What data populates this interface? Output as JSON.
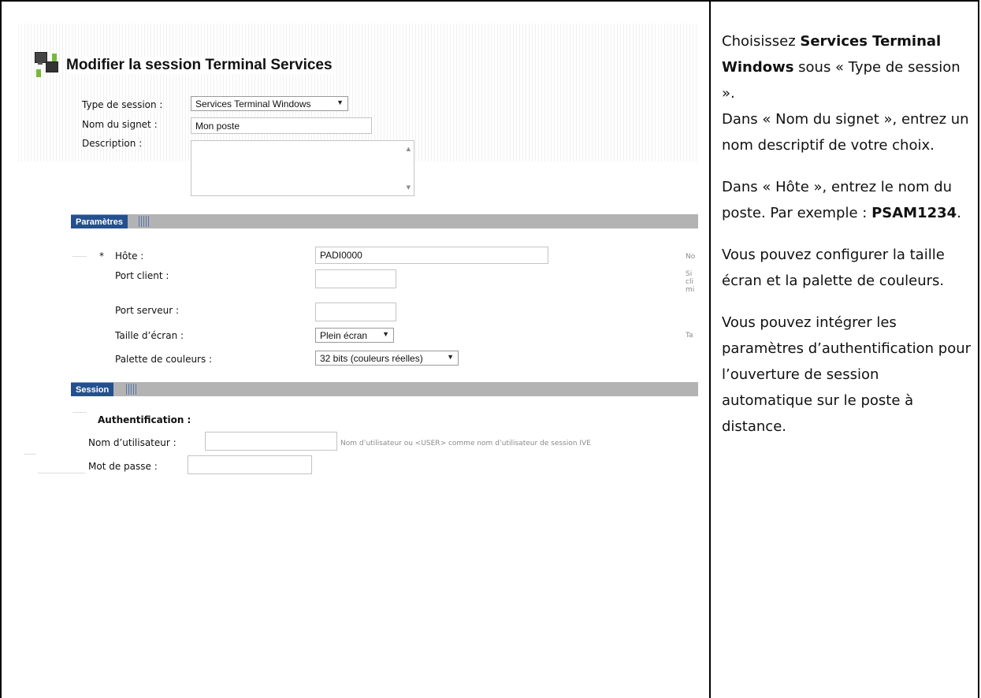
{
  "screenshot": {
    "title": "Modifier la session Terminal Services",
    "session_type_label": "Type de session :",
    "session_type_value": "Services Terminal Windows",
    "bookmark_label": "Nom du signet :",
    "bookmark_value": "Mon poste",
    "description_label": "Description :",
    "sections": {
      "parametres": "Paramètres",
      "session": "Session"
    },
    "params": {
      "required_mark": "*",
      "host_label": "Hôte :",
      "host_value": "PADI0000",
      "host_hint": "No",
      "client_port_label": "Port client :",
      "client_port_hint": "Si",
      "client_port_hint2": "cli",
      "client_port_hint3": "mi",
      "server_port_label": "Port serveur :",
      "screen_size_label": "Taille d’écran :",
      "screen_size_value": "Plein écran",
      "screen_size_hint": "Ta",
      "palette_label": "Palette de couleurs :",
      "palette_value": "32 bits (couleurs réelles)"
    },
    "session": {
      "auth_heading": "Authentification :",
      "username_label": "Nom d’utilisateur :",
      "username_hint": "Nom d’utilisateur ou <USER> comme nom d’utilisateur de session IVE",
      "password_label": "Mot de passe :"
    }
  },
  "instructions": {
    "p1_pre": "Choisissez ",
    "p1_bold": "Services Terminal Windows",
    "p1_post": " sous « Type de session ».",
    "p2": "Dans « Nom du signet », entrez un nom descriptif de votre choix.",
    "p3_pre": "Dans « Hôte »,  entrez le nom du poste. Par exemple : ",
    "p3_bold": "PSAM1234",
    "p3_post": ".",
    "p4": "Vous pouvez configurer la taille écran et la palette de couleurs.",
    "p5": "Vous pouvez intégrer les paramètres d’authentification pour l’ouverture de session automatique sur le poste à distance."
  }
}
